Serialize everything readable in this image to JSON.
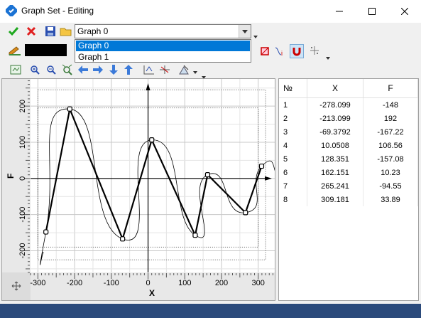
{
  "window": {
    "title": "Graph Set - Editing"
  },
  "graph_selector": {
    "selected": "Graph 0",
    "options": [
      "Graph 0",
      "Graph 1"
    ]
  },
  "toolbar": {
    "accept": "check-icon",
    "cancel": "cross-icon",
    "save": "floppy-icon",
    "open": "folder-icon",
    "line_style": "pen-icon",
    "color": "#000000"
  },
  "axes": {
    "x_label": "X",
    "y_label": "F",
    "x_ticks": [
      "-300",
      "-200",
      "-100",
      "0",
      "100",
      "200",
      "300"
    ],
    "y_ticks": [
      "200",
      "100",
      "0",
      "-100",
      "-200"
    ]
  },
  "chart_data": {
    "type": "line",
    "xlabel": "X",
    "ylabel": "F",
    "xlim": [
      -320,
      345
    ],
    "ylim": [
      -260,
      275
    ],
    "grid": true,
    "series": [
      {
        "x": [
          -278.099,
          -213.099,
          -69.3792,
          10.0508,
          128.351,
          162.151,
          265.241,
          309.181
        ],
        "y": [
          -148,
          192,
          -167.22,
          106.56,
          -157.08,
          10.23,
          -94.55,
          33.89
        ]
      }
    ]
  },
  "table": {
    "headers": [
      "№",
      "X",
      "F"
    ],
    "rows": [
      [
        "1",
        "-278.099",
        "-148"
      ],
      [
        "2",
        "-213.099",
        "192"
      ],
      [
        "3",
        "-69.3792",
        "-167.22"
      ],
      [
        "4",
        "10.0508",
        "106.56"
      ],
      [
        "5",
        "128.351",
        "-157.08"
      ],
      [
        "6",
        "162.151",
        "10.23"
      ],
      [
        "7",
        "265.241",
        "-94.55"
      ],
      [
        "8",
        "309.181",
        "33.89"
      ]
    ]
  }
}
